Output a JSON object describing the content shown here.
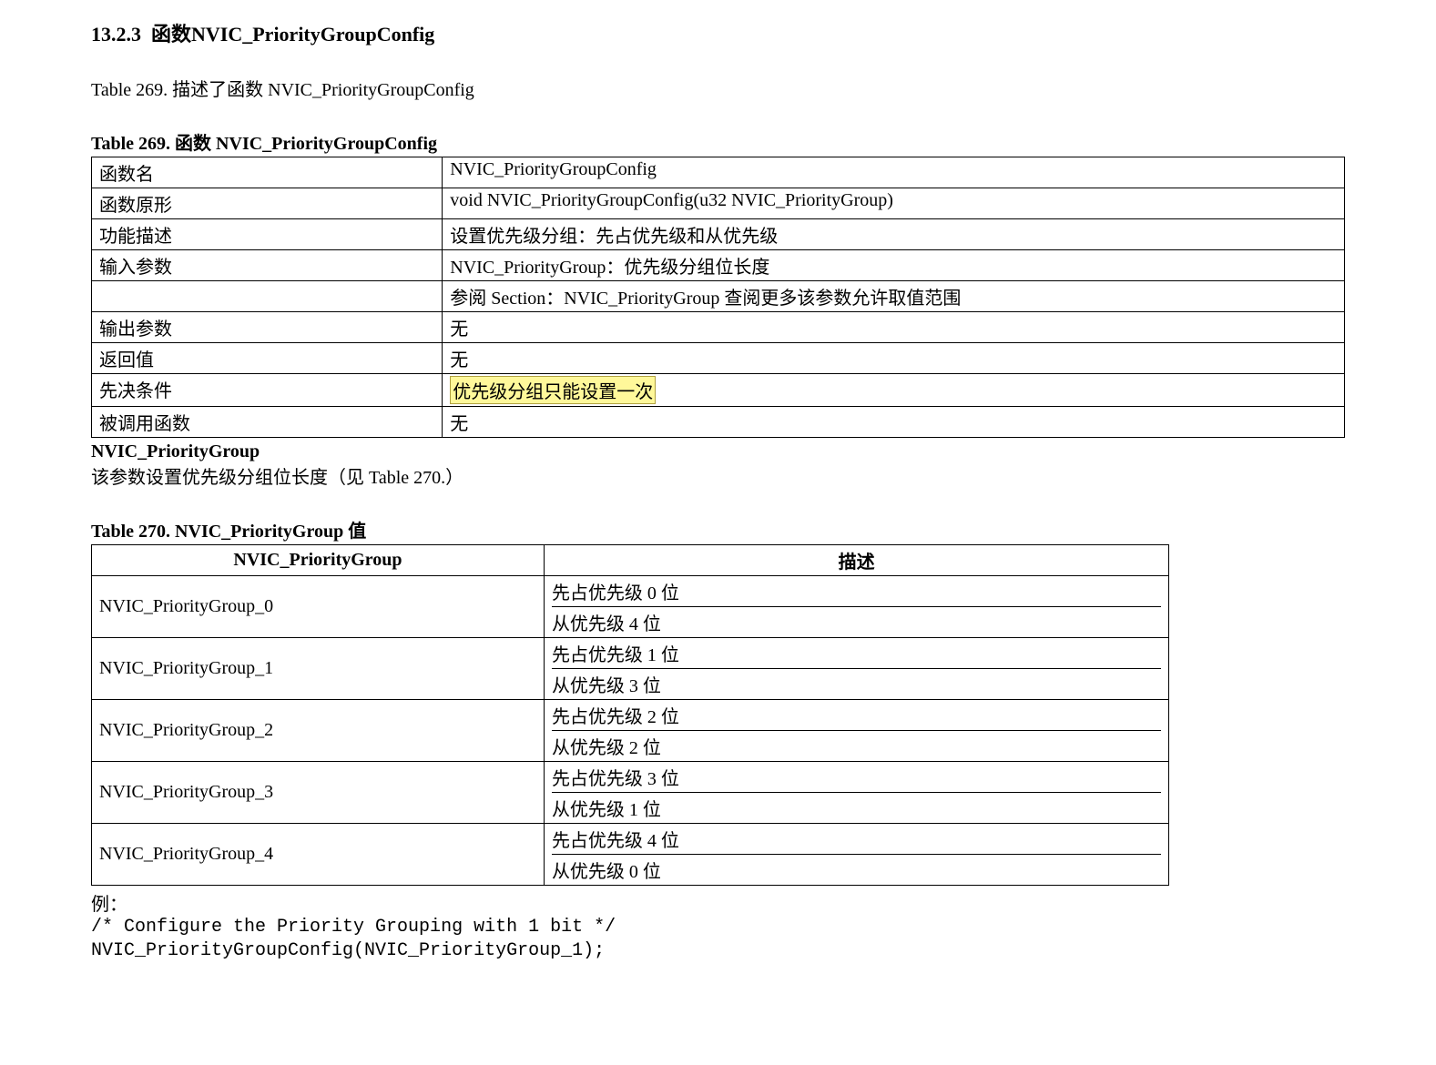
{
  "section": {
    "number": "13.2.3",
    "title_prefix": "函数",
    "title_name": "NVIC_PriorityGroupConfig"
  },
  "intro": "Table 269.  描述了函数 NVIC_PriorityGroupConfig",
  "table269": {
    "caption": "Table 269.  函数 NVIC_PriorityGroupConfig",
    "rows": {
      "func_name": {
        "label": "函数名",
        "value": "NVIC_PriorityGroupConfig"
      },
      "prototype": {
        "label": "函数原形",
        "value": "void NVIC_PriorityGroupConfig(u32 NVIC_PriorityGroup)"
      },
      "desc": {
        "label": "功能描述",
        "value": "设置优先级分组：先占优先级和从优先级"
      },
      "input_param": {
        "label": "输入参数",
        "line1": "NVIC_PriorityGroup：优先级分组位长度",
        "line2": "参阅 Section：NVIC_PriorityGroup  查阅更多该参数允许取值范围"
      },
      "output_param": {
        "label": "输出参数",
        "value": "无"
      },
      "return_val": {
        "label": "返回值",
        "value": "无"
      },
      "precondition": {
        "label": "先决条件",
        "value": "优先级分组只能设置一次"
      },
      "called_func": {
        "label": "被调用函数",
        "value": "无"
      }
    }
  },
  "subhead": "NVIC_PriorityGroup",
  "subdesc": "该参数设置优先级分组位长度（见  Table 270.）",
  "table270": {
    "caption": "Table 270. NVIC_PriorityGroup 值",
    "headers": {
      "col1": "NVIC_PriorityGroup",
      "col2": "描述"
    },
    "rows": [
      {
        "name": "NVIC_PriorityGroup_0",
        "desc1": "先占优先级 0 位",
        "desc2": "从优先级 4 位"
      },
      {
        "name": "NVIC_PriorityGroup_1",
        "desc1": "先占优先级 1 位",
        "desc2": "从优先级 3 位"
      },
      {
        "name": "NVIC_PriorityGroup_2",
        "desc1": "先占优先级 2 位",
        "desc2": "从优先级 2 位"
      },
      {
        "name": "NVIC_PriorityGroup_3",
        "desc1": "先占优先级 3 位",
        "desc2": "从优先级 1 位"
      },
      {
        "name": "NVIC_PriorityGroup_4",
        "desc1": "先占优先级 4 位",
        "desc2": "从优先级 0 位"
      }
    ]
  },
  "example": {
    "label": "例：",
    "code": "/* Configure the Priority Grouping with 1 bit */\nNVIC_PriorityGroupConfig(NVIC_PriorityGroup_1);"
  }
}
